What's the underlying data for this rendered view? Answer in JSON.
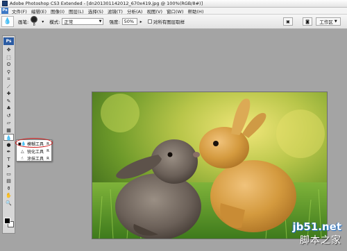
{
  "window": {
    "title": "Adobe Photoshop CS3 Extended - [dn201301142012_670x419.jpg @ 100%(RGB/8#)]"
  },
  "menubar": {
    "logo": "Ps",
    "items": [
      "文件(F)",
      "编辑(E)",
      "图像(I)",
      "图层(L)",
      "选择(S)",
      "滤镜(T)",
      "分析(A)",
      "视图(V)",
      "窗口(W)",
      "帮助(H)"
    ]
  },
  "options": {
    "brush_label": "画笔:",
    "brush_size": "8",
    "mode_label": "模式:",
    "mode_value": "正常",
    "strength_label": "强度:",
    "strength_value": "50%",
    "sample_all_label": "对所有图层取样",
    "workspace_label": "工作区"
  },
  "toolbox": {
    "logo": "Ps",
    "tools": [
      {
        "name": "move-tool-icon",
        "glyph": "✥"
      },
      {
        "name": "marquee-tool-icon",
        "glyph": "⬚"
      },
      {
        "name": "lasso-tool-icon",
        "glyph": "ʘ"
      },
      {
        "name": "magic-wand-tool-icon",
        "glyph": "⚲"
      },
      {
        "name": "crop-tool-icon",
        "glyph": "⌗"
      },
      {
        "name": "slice-tool-icon",
        "glyph": "⟋"
      },
      {
        "name": "healing-brush-tool-icon",
        "glyph": "✚"
      },
      {
        "name": "brush-tool-icon",
        "glyph": "✎"
      },
      {
        "name": "clone-stamp-tool-icon",
        "glyph": "♣"
      },
      {
        "name": "history-brush-tool-icon",
        "glyph": "↺"
      },
      {
        "name": "eraser-tool-icon",
        "glyph": "▱"
      },
      {
        "name": "gradient-tool-icon",
        "glyph": "▦"
      },
      {
        "name": "blur-tool-icon",
        "glyph": "💧",
        "active": true
      },
      {
        "name": "dodge-tool-icon",
        "glyph": "●"
      },
      {
        "name": "pen-tool-icon",
        "glyph": "✒"
      },
      {
        "name": "type-tool-icon",
        "glyph": "T"
      },
      {
        "name": "path-selection-tool-icon",
        "glyph": "➤"
      },
      {
        "name": "shape-tool-icon",
        "glyph": "▭"
      },
      {
        "name": "notes-tool-icon",
        "glyph": "▤"
      },
      {
        "name": "eyedropper-tool-icon",
        "glyph": "⚱"
      },
      {
        "name": "hand-tool-icon",
        "glyph": "✋"
      },
      {
        "name": "zoom-tool-icon",
        "glyph": "🔍"
      }
    ]
  },
  "flyout": {
    "items": [
      {
        "label": "模糊工具",
        "key": "R",
        "selected": true
      },
      {
        "label": "锐化工具",
        "key": "R",
        "selected": false
      },
      {
        "label": "涂抹工具",
        "key": "R",
        "selected": false
      }
    ]
  },
  "watermark": {
    "site": "jb51.net",
    "text": "脚本之家"
  },
  "colors": {
    "highlight": "#d21c1c",
    "workspace": "#a4a4a4",
    "foreground": "#000000",
    "background": "#ffffff"
  }
}
